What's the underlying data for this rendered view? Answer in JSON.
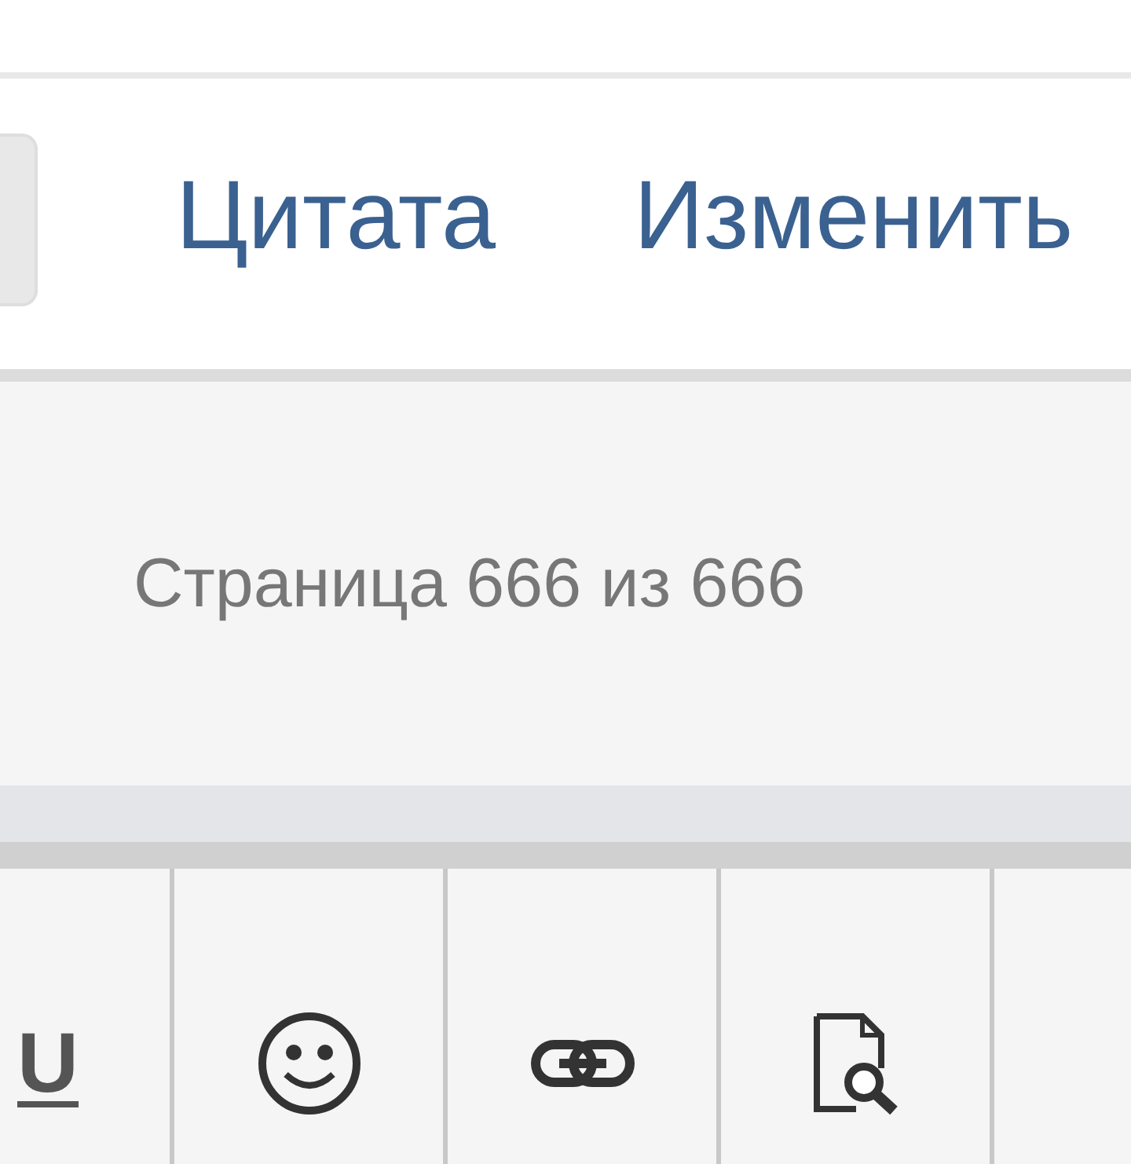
{
  "actions": [
    {
      "label": "Цитата"
    },
    {
      "label": "Изменить"
    }
  ],
  "pagination": {
    "text": "Страница 666 из 666"
  },
  "toolbar": [
    {
      "kind": "underline",
      "label": "U"
    },
    {
      "kind": "smiley"
    },
    {
      "kind": "link"
    },
    {
      "kind": "preview"
    }
  ]
}
